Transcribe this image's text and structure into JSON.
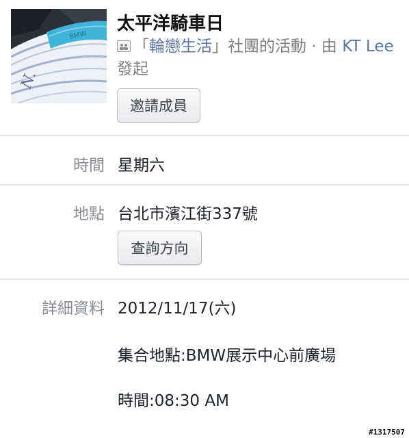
{
  "event": {
    "title": "太平洋騎車日",
    "group_prefix": "「",
    "group_name": "輪戀生活",
    "group_suffix": "」社團的活動 · 由 ",
    "organizer": "KT Lee",
    "organizer_suffix": " 發起",
    "invite_button": "邀請成員"
  },
  "details": {
    "time_label": "時間",
    "time_value": "星期六",
    "place_label": "地點",
    "place_value": "台北市濱江街337號",
    "directions_button": "查詢方向",
    "info_label": "詳細資料",
    "info_lines": [
      "2012/11/17(六)",
      "集合地點:BMW展示中心前廣場",
      "時間:08:30 AM"
    ]
  },
  "watermark": "#1317507"
}
